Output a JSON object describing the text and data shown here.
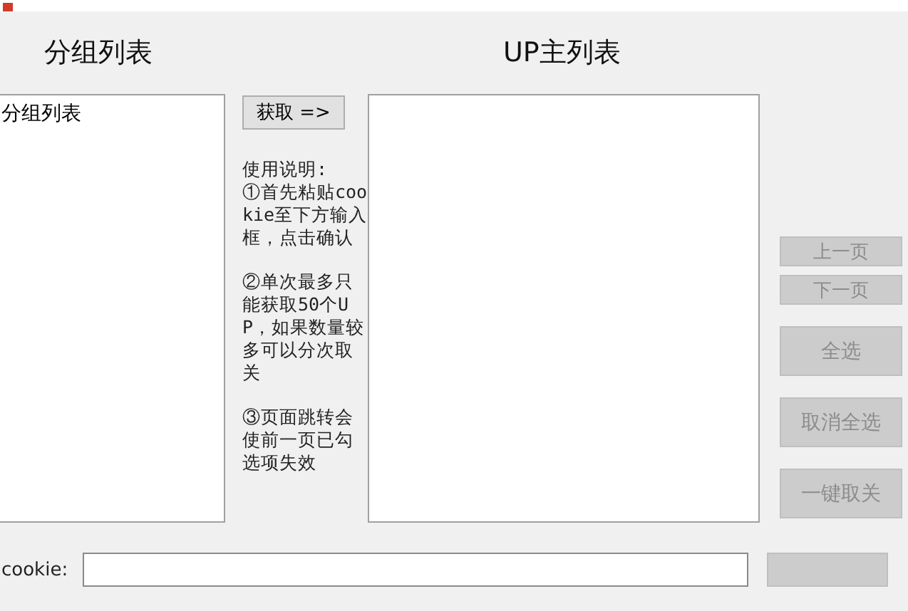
{
  "group_panel": {
    "heading": "分组列表",
    "items": [
      {
        "label": "分组列表"
      }
    ]
  },
  "fetch_button": {
    "label": "获取 =>",
    "disabled": false
  },
  "instructions": [
    "使用说明:\n①首先粘贴cookie至下方输入框，点击确认",
    "②单次最多只能获取50个UP，如果数量较多可以分次取关",
    "③页面跳转会使前一页已勾选项失效"
  ],
  "up_panel": {
    "heading": "UP主列表"
  },
  "side_buttons": [
    {
      "label": "上一页",
      "kind": "nav",
      "disabled": true
    },
    {
      "label": "下一页",
      "kind": "nav",
      "disabled": true
    },
    {
      "label": "全选",
      "kind": "action",
      "disabled": true
    },
    {
      "label": "取消全选",
      "kind": "action",
      "disabled": true
    },
    {
      "label": "一键取关",
      "kind": "action",
      "disabled": true
    }
  ],
  "cookie": {
    "label": "cookie:"
  }
}
